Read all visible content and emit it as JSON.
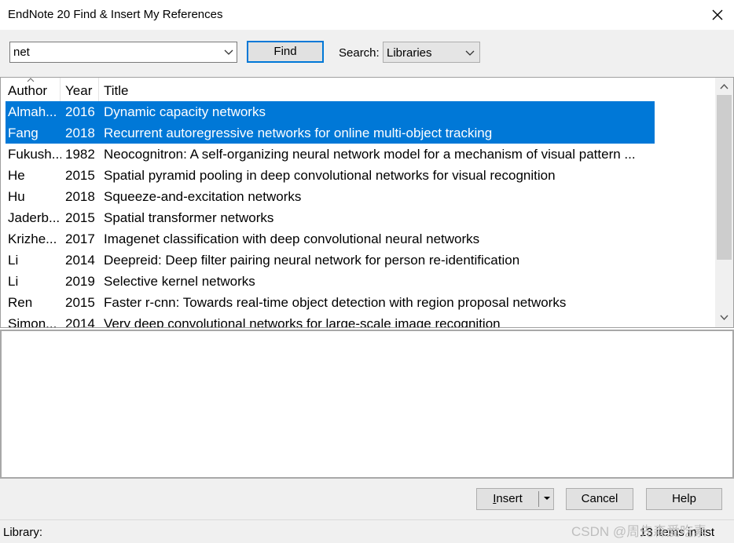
{
  "window": {
    "title": "EndNote 20 Find & Insert My References"
  },
  "toolbar": {
    "search_value": "net",
    "find_label": "Find",
    "search_label": "Search:",
    "search_scope": "Libraries"
  },
  "table": {
    "columns": [
      "Author",
      "Year",
      "Title"
    ],
    "rows": [
      {
        "author": "Almah...",
        "year": "2016",
        "title": "Dynamic capacity networks",
        "selected": true
      },
      {
        "author": "Fang",
        "year": "2018",
        "title": "Recurrent autoregressive networks for online multi-object tracking",
        "selected": true
      },
      {
        "author": "Fukush...",
        "year": "1982",
        "title": "Neocognitron: A self-organizing neural network model for a mechanism of visual pattern ...",
        "selected": false
      },
      {
        "author": "He",
        "year": "2015",
        "title": "Spatial pyramid pooling in deep convolutional networks for visual recognition",
        "selected": false
      },
      {
        "author": "Hu",
        "year": "2018",
        "title": "Squeeze-and-excitation networks",
        "selected": false
      },
      {
        "author": "Jaderb...",
        "year": "2015",
        "title": "Spatial transformer networks",
        "selected": false
      },
      {
        "author": "Krizhe...",
        "year": "2017",
        "title": "Imagenet classification with deep convolutional neural networks",
        "selected": false
      },
      {
        "author": "Li",
        "year": "2014",
        "title": "Deepreid: Deep filter pairing neural network for person re-identification",
        "selected": false
      },
      {
        "author": "Li",
        "year": "2019",
        "title": "Selective kernel networks",
        "selected": false
      },
      {
        "author": "Ren",
        "year": "2015",
        "title": "Faster r-cnn: Towards real-time object detection with region proposal networks",
        "selected": false
      },
      {
        "author": "Simon...",
        "year": "2014",
        "title": "Very deep convolutional networks for large-scale image recognition",
        "selected": false
      }
    ],
    "sort_indicator": "sort-ascending-caret-icon"
  },
  "buttons": {
    "insert_label_accel": "I",
    "insert_label_rest": "nsert",
    "cancel_label": "Cancel",
    "help_label": "Help"
  },
  "status": {
    "library_label": "Library:",
    "item_count": "13 items in list"
  },
  "watermark": "CSDN @周先森爱吃素",
  "colors": {
    "selection": "#0078d7",
    "focus_border": "#0078d7",
    "toolbar_bg": "#f0f0f0"
  }
}
